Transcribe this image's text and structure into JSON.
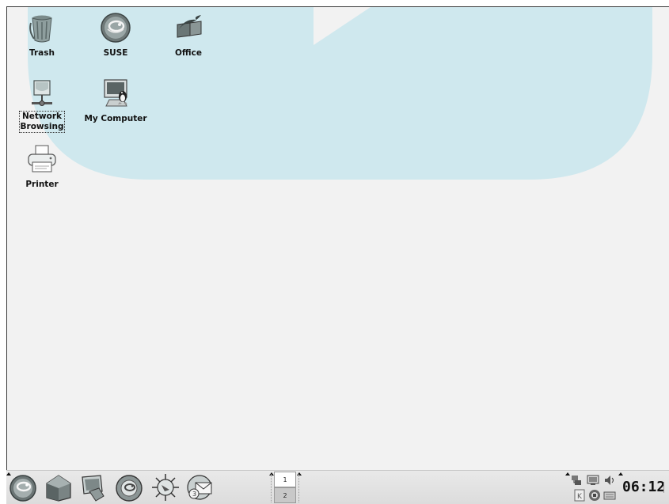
{
  "desktop": {
    "icons": [
      {
        "label": "Trash",
        "icon": "trash-icon"
      },
      {
        "label": "SUSE",
        "icon": "suse-icon"
      },
      {
        "label": "Office",
        "icon": "office-icon"
      },
      {
        "label_line1": "Network",
        "label_line2": "Browsing",
        "icon": "network-icon"
      },
      {
        "label": "My Computer",
        "icon": "computer-icon"
      },
      {
        "label": "Printer",
        "icon": "printer-icon"
      }
    ],
    "wallpaper_color": "#cfe8ee"
  },
  "panel": {
    "launchers": [
      "suse-menu-icon",
      "home-icon",
      "desktop-icon",
      "suse-help-icon",
      "konqueror-icon",
      "email-icon"
    ],
    "pager": {
      "desktops": [
        "1",
        "2"
      ],
      "active": "1"
    },
    "tray_icons": [
      "network-tray-icon",
      "display-tray-icon",
      "volume-tray-icon",
      "kde-tray-icon",
      "updater-tray-icon",
      "keyboard-tray-icon"
    ],
    "clock": "06:12"
  },
  "colors": {
    "desktop_bg": "#f2f2f2",
    "panel_bg": "#e2e2e2",
    "suse_green": "#6a6a6a"
  }
}
